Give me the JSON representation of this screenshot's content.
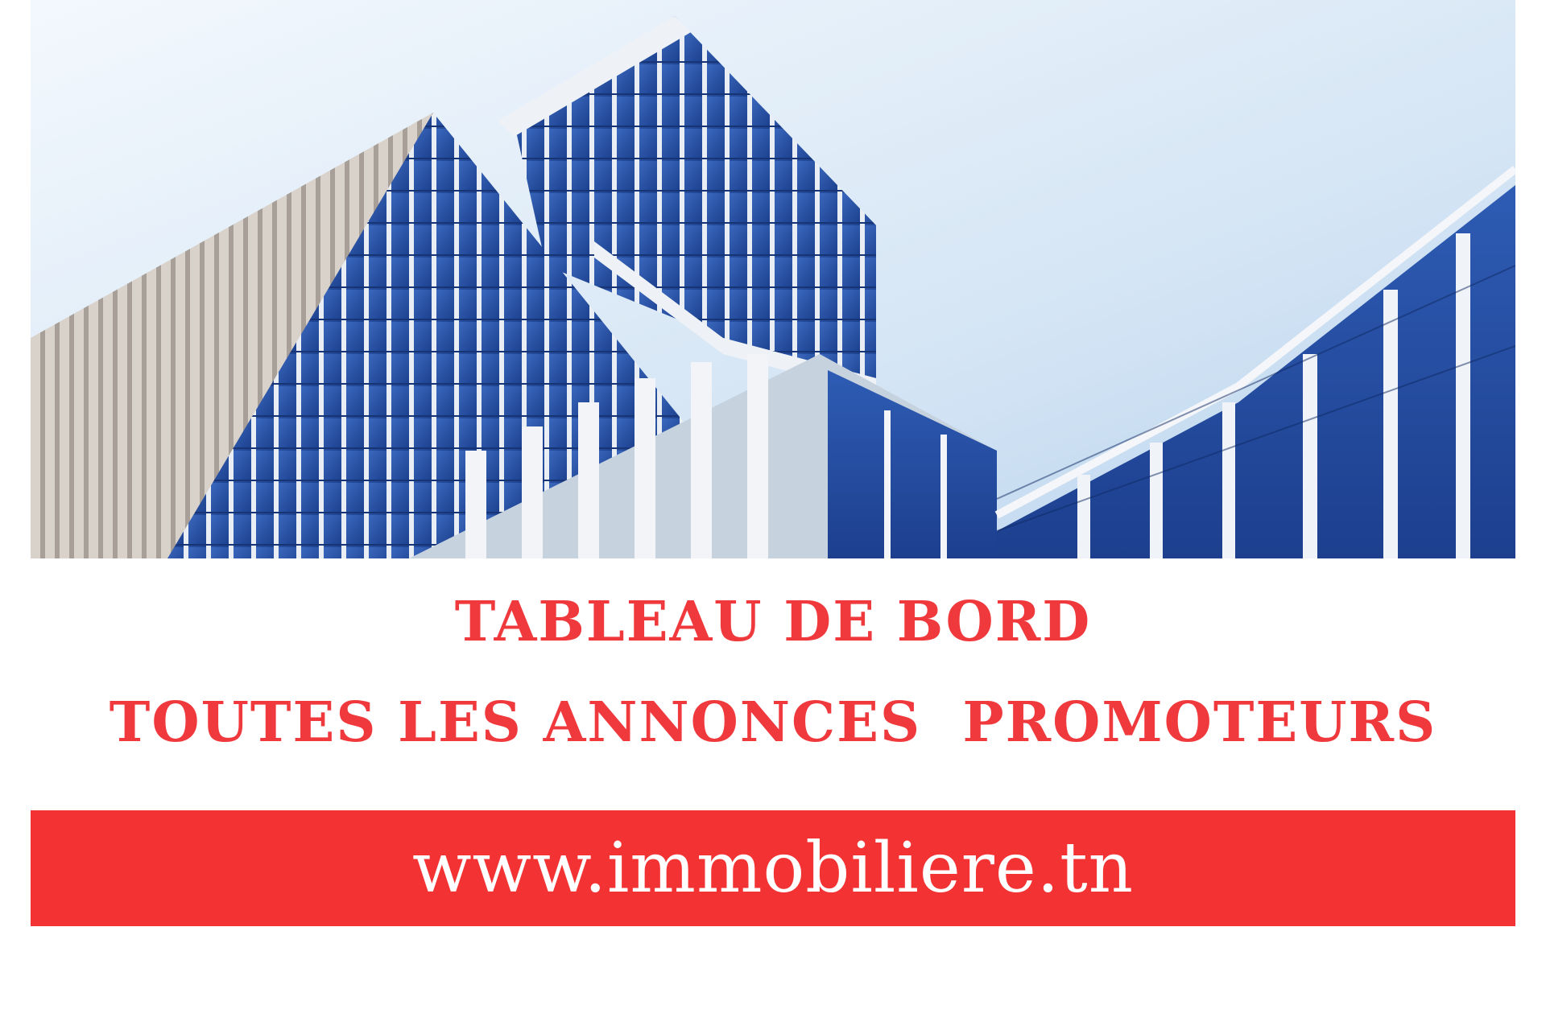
{
  "hero": {
    "description_icon": "glass-office-buildings-photo"
  },
  "headline": {
    "line1": "TABLEAU DE BORD",
    "line2": "TOUTES LES ANNONCES  PROMOTEURS"
  },
  "banner": {
    "url": "www.immobiliere.tn"
  },
  "colors": {
    "accent_red": "#f33333",
    "title_red": "#f0393d",
    "glass_blue": "#2a56a8",
    "sky": "#dbe9f6"
  }
}
